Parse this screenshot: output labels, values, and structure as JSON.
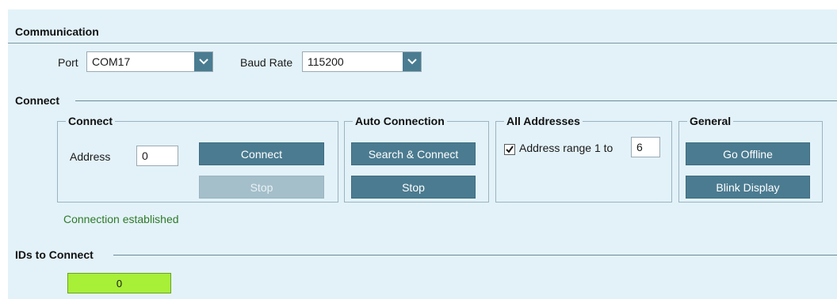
{
  "communication": {
    "title": "Communication",
    "port_label": "Port",
    "port_value": "COM17",
    "baud_label": "Baud Rate",
    "baud_value": "115200"
  },
  "connect_section": {
    "title": "Connect",
    "connect_group": {
      "title": "Connect",
      "address_label": "Address",
      "address_value": "0",
      "connect_button": "Connect",
      "stop_button": "Stop"
    },
    "auto_group": {
      "title": "Auto Connection",
      "search_button": "Search & Connect",
      "stop_button": "Stop"
    },
    "all_group": {
      "title": "All Addresses",
      "checkbox_label": "Address range 1 to",
      "checkbox_checked": true,
      "range_value": "6"
    },
    "general_group": {
      "title": "General",
      "offline_button": "Go Offline",
      "blink_button": "Blink Display"
    },
    "status": "Connection established"
  },
  "ids_section": {
    "title": "IDs to Connect",
    "value": "0"
  },
  "colors": {
    "panel_bg": "#e3f2f9",
    "button": "#4b7b90",
    "button_disabled": "#a4bfca",
    "status_green": "#2f7a2a",
    "id_green": "#a8ef38"
  }
}
